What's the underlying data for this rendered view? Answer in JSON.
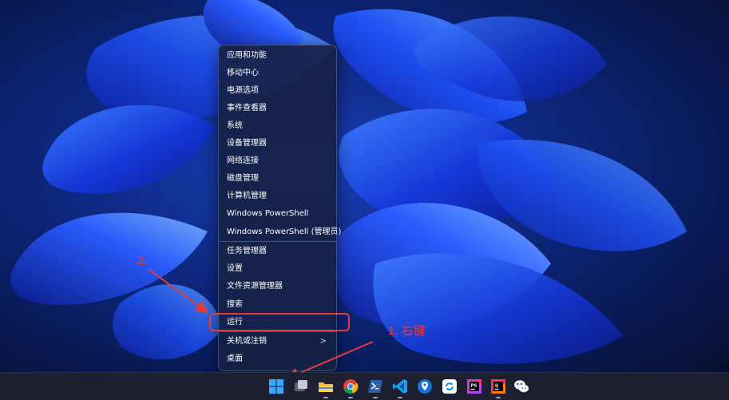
{
  "menu": {
    "items": [
      {
        "label": "应用和功能"
      },
      {
        "label": "移动中心"
      },
      {
        "label": "电源选项"
      },
      {
        "label": "事件查看器"
      },
      {
        "label": "系统"
      },
      {
        "label": "设备管理器"
      },
      {
        "label": "网络连接"
      },
      {
        "label": "磁盘管理"
      },
      {
        "label": "计算机管理"
      },
      {
        "label": "Windows PowerShell"
      },
      {
        "label": "Windows PowerShell (管理员)"
      },
      {
        "label": "任务管理器"
      },
      {
        "label": "设置"
      },
      {
        "label": "文件资源管理器"
      },
      {
        "label": "搜索"
      },
      {
        "label": "运行"
      },
      {
        "label": "关机或注销",
        "submenu": ">"
      },
      {
        "label": "桌面"
      }
    ]
  },
  "annotations": {
    "step1": "1. 右键",
    "step2": "2."
  },
  "taskbar": {
    "icons": [
      {
        "name": "start-button",
        "icon": "windows-logo-icon"
      },
      {
        "name": "task-view",
        "icon": "task-view-icon"
      },
      {
        "name": "file-explorer",
        "icon": "folder-icon"
      },
      {
        "name": "chrome",
        "icon": "chrome-icon"
      },
      {
        "name": "powershell",
        "icon": "powershell-icon"
      },
      {
        "name": "vscode",
        "icon": "vscode-icon"
      },
      {
        "name": "maps",
        "icon": "map-pin-icon"
      },
      {
        "name": "sync-app",
        "icon": "sync-icon"
      },
      {
        "name": "phpstorm",
        "icon": "phpstorm-icon"
      },
      {
        "name": "intellij",
        "icon": "intellij-icon"
      },
      {
        "name": "wechat",
        "icon": "wechat-icon"
      }
    ]
  },
  "colors": {
    "annotation": "#e23c3c",
    "menu_background": "#162244",
    "taskbar": "#1c2030"
  }
}
